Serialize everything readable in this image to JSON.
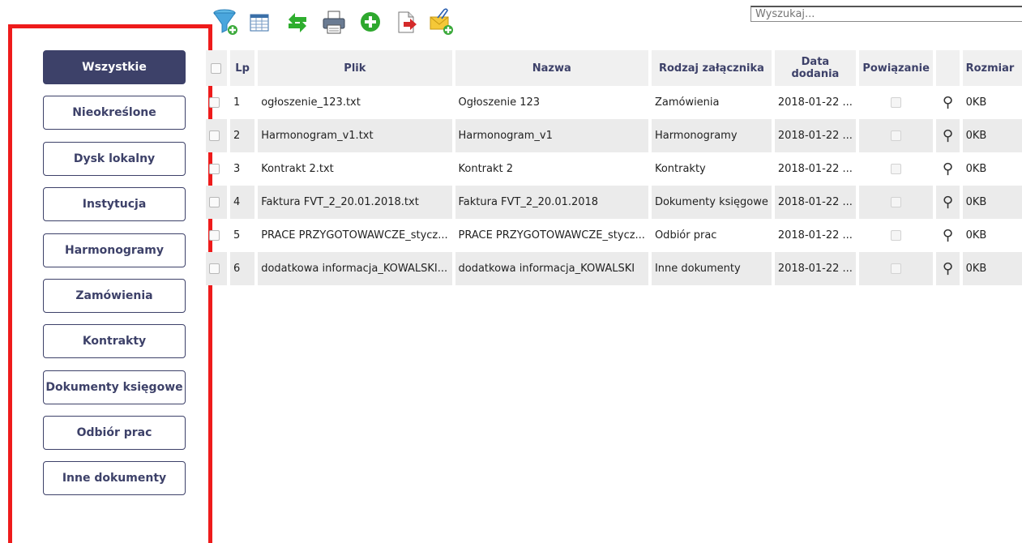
{
  "sidebar": {
    "categories": [
      {
        "label": "Wszystkie",
        "active": true
      },
      {
        "label": "Nieokreślone"
      },
      {
        "label": "Dysk lokalny"
      },
      {
        "label": "Instytucja"
      },
      {
        "label": "Harmonogramy"
      },
      {
        "label": "Zamówienia"
      },
      {
        "label": "Kontrakty"
      },
      {
        "label": "Dokumenty księgowe"
      },
      {
        "label": "Odbiór prac"
      },
      {
        "label": "Inne dokumenty"
      }
    ]
  },
  "toolbar": {
    "icons": [
      "filter-add-icon",
      "table-columns-icon",
      "refresh-icon",
      "print-icon",
      "add-icon",
      "export-icon",
      "attach-mail-icon"
    ]
  },
  "search": {
    "placeholder": "Wyszukaj..."
  },
  "table": {
    "headers": {
      "lp": "Lp",
      "plik": "Plik",
      "nazwa": "Nazwa",
      "rodzaj": "Rodzaj załącznika",
      "data": "Data dodania",
      "powiazanie": "Powiązanie",
      "rozmiar": "Rozmiar"
    },
    "rows": [
      {
        "lp": "1",
        "plik": "ogłoszenie_123.txt",
        "nazwa": "Ogłoszenie 123",
        "rodzaj": "Zamówienia",
        "data": "2018-01-22 ...",
        "rozmiar": "0KB"
      },
      {
        "lp": "2",
        "plik": "Harmonogram_v1.txt",
        "nazwa": "Harmonogram_v1",
        "rodzaj": "Harmonogramy",
        "data": "2018-01-22 ...",
        "rozmiar": "0KB"
      },
      {
        "lp": "3",
        "plik": "Kontrakt 2.txt",
        "nazwa": "Kontrakt 2",
        "rodzaj": "Kontrakty",
        "data": "2018-01-22 ...",
        "rozmiar": "0KB"
      },
      {
        "lp": "4",
        "plik": "Faktura FVT_2_20.01.2018.txt",
        "nazwa": "Faktura FVT_2_20.01.2018",
        "rodzaj": "Dokumenty księgowe",
        "data": "2018-01-22 ...",
        "rozmiar": "0KB"
      },
      {
        "lp": "5",
        "plik": "PRACE PRZYGOTOWAWCZE_stycz...",
        "nazwa": "PRACE PRZYGOTOWAWCZE_stycz...",
        "rodzaj": "Odbiór prac",
        "data": "2018-01-22 ...",
        "rozmiar": "0KB"
      },
      {
        "lp": "6",
        "plik": "dodatkowa informacja_KOWALSKI...",
        "nazwa": "dodatkowa informacja_KOWALSKI",
        "rodzaj": "Inne dokumenty",
        "data": "2018-01-22 ...",
        "rozmiar": "0KB"
      }
    ]
  },
  "colors": {
    "accent": "#3d4169",
    "highlight_frame": "#ee1b1b",
    "row_alt": "#ebebeb"
  }
}
